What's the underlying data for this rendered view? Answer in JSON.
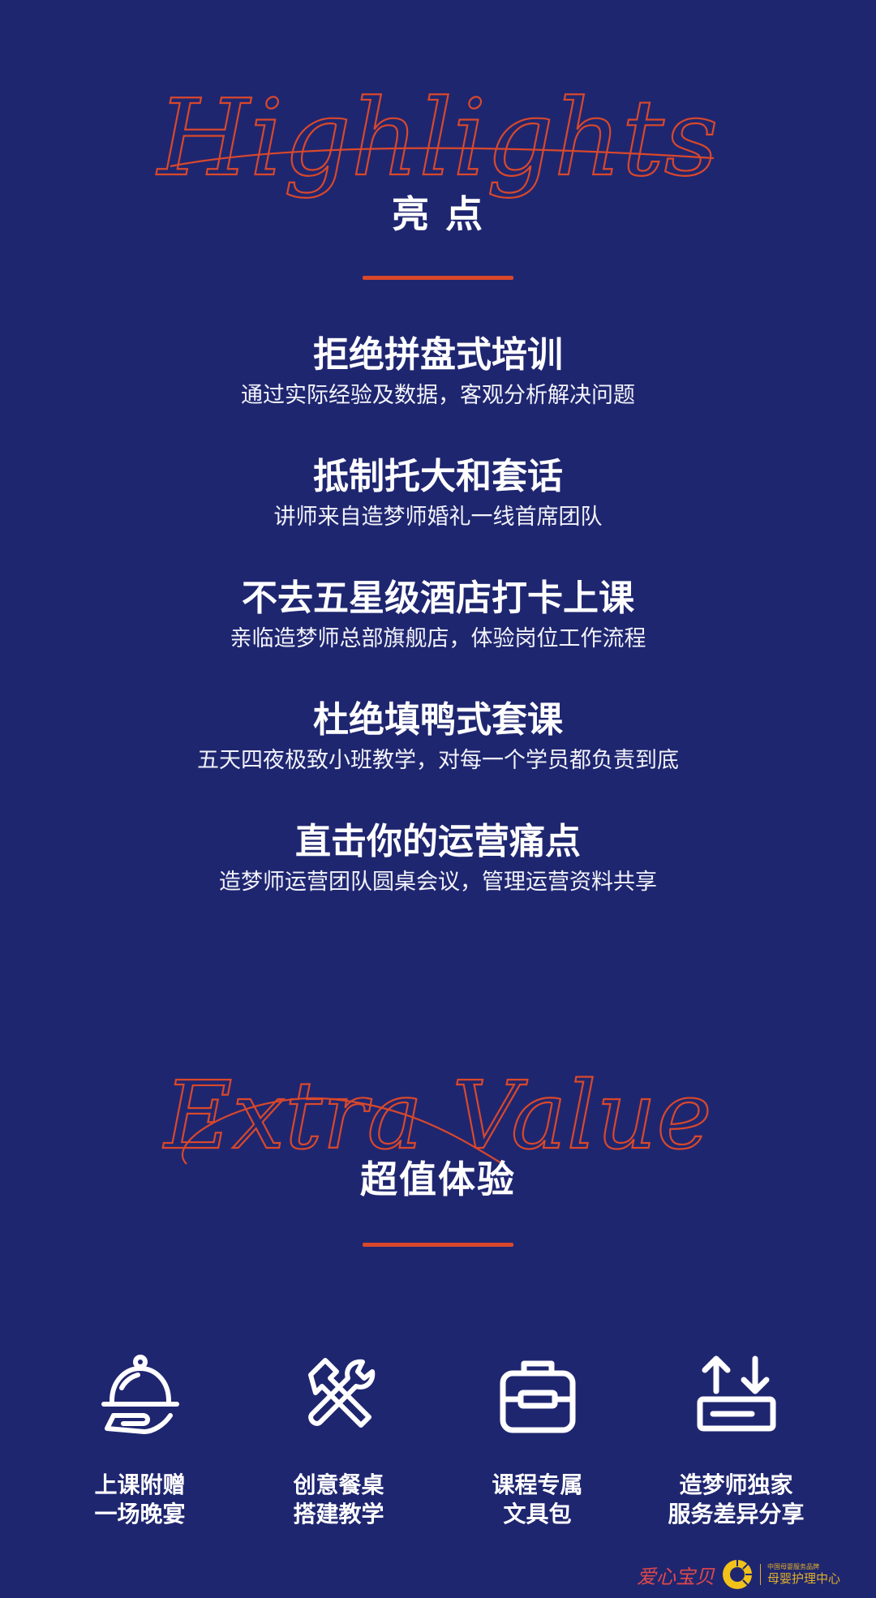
{
  "highlights_section": {
    "script_title": "Highlights",
    "zh_title": "亮 点",
    "items": [
      {
        "title": "拒绝拼盘式培训",
        "desc": "通过实际经验及数据，客观分析解决问题"
      },
      {
        "title": "抵制托大和套话",
        "desc": "讲师来自造梦师婚礼一线首席团队"
      },
      {
        "title": "不去五星级酒店打卡上课",
        "desc": "亲临造梦师总部旗舰店，体验岗位工作流程"
      },
      {
        "title": "杜绝填鸭式套课",
        "desc": "五天四夜极致小班教学，对每一个学员都负责到底"
      },
      {
        "title": "直击你的运营痛点",
        "desc": "造梦师运营团队圆桌会议，管理运营资料共享"
      }
    ]
  },
  "extra_section": {
    "script_title": "Extra Value",
    "zh_title": "超值体验",
    "features": [
      {
        "icon": "cloche-icon",
        "line1": "上课附赠",
        "line2": "一场晚宴"
      },
      {
        "icon": "tools-icon",
        "line1": "创意餐桌",
        "line2": "搭建教学"
      },
      {
        "icon": "toolbox-icon",
        "line1": "课程专属",
        "line2": "文具包"
      },
      {
        "icon": "download-box-icon",
        "line1": "造梦师独家",
        "line2": "服务差异分享"
      }
    ]
  },
  "footer": {
    "brand_left": "爱心宝贝",
    "brand_small": "中国母婴服务品牌",
    "brand_main": "母婴护理中心"
  },
  "colors": {
    "background": "#1f2670",
    "accent": "#d9482b",
    "text": "#ffffff",
    "logo": "#e0b02a"
  }
}
